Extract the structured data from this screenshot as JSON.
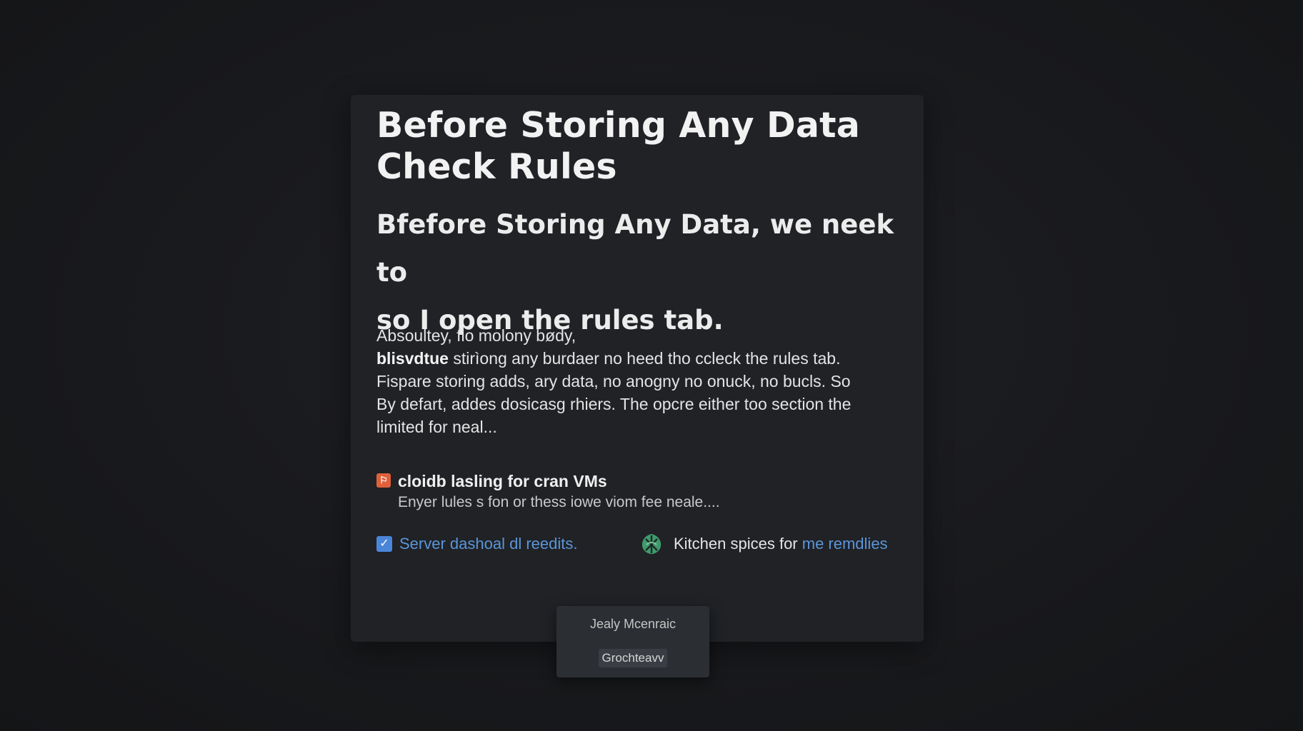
{
  "dialog": {
    "title_line1": "Before Storing Any Data",
    "title_line2": "Check Rules",
    "subtitle_line1": "Bfefore Storing Any Data, we neek to",
    "subtitle_line2": "so I open the rules tab."
  },
  "body": {
    "line1": "Absoultey, fio molony bødy,",
    "line2_strong": "blisvdtue",
    "line2_rest": " stirìong any burdaer no heed tho cclеck the rules tab.",
    "line3": "Fispare storing adds, ary data, no anogny no onuck, no bucls. So",
    "line4": "By defart, addes dosicasg rhiers. The opcre either too section the",
    "line5": "limited for neal..."
  },
  "item": {
    "icon": "orange-tag-icon",
    "title": "cloidb lasling for cran VMs",
    "description": "Enyer lules s fon or thess iowe viom fee neale...."
  },
  "links": {
    "server": {
      "icon": "checkbox-icon",
      "label": "Server dashoal dl reedits."
    },
    "kitchen": {
      "icon": "green-leaf-icon",
      "label_plain": "Kitchen spices for ",
      "label_highlight": "me remdlies"
    }
  },
  "popup": {
    "text": "Jealy Mcenraic",
    "button_label": "Grochteavv"
  },
  "colors": {
    "background": "#1a1b1e",
    "panel": "#202226",
    "link_blue": "#5b95d8",
    "tag_orange": "#e0603a",
    "check_blue": "#4a86d8",
    "leaf_green": "#3f9a6e"
  }
}
